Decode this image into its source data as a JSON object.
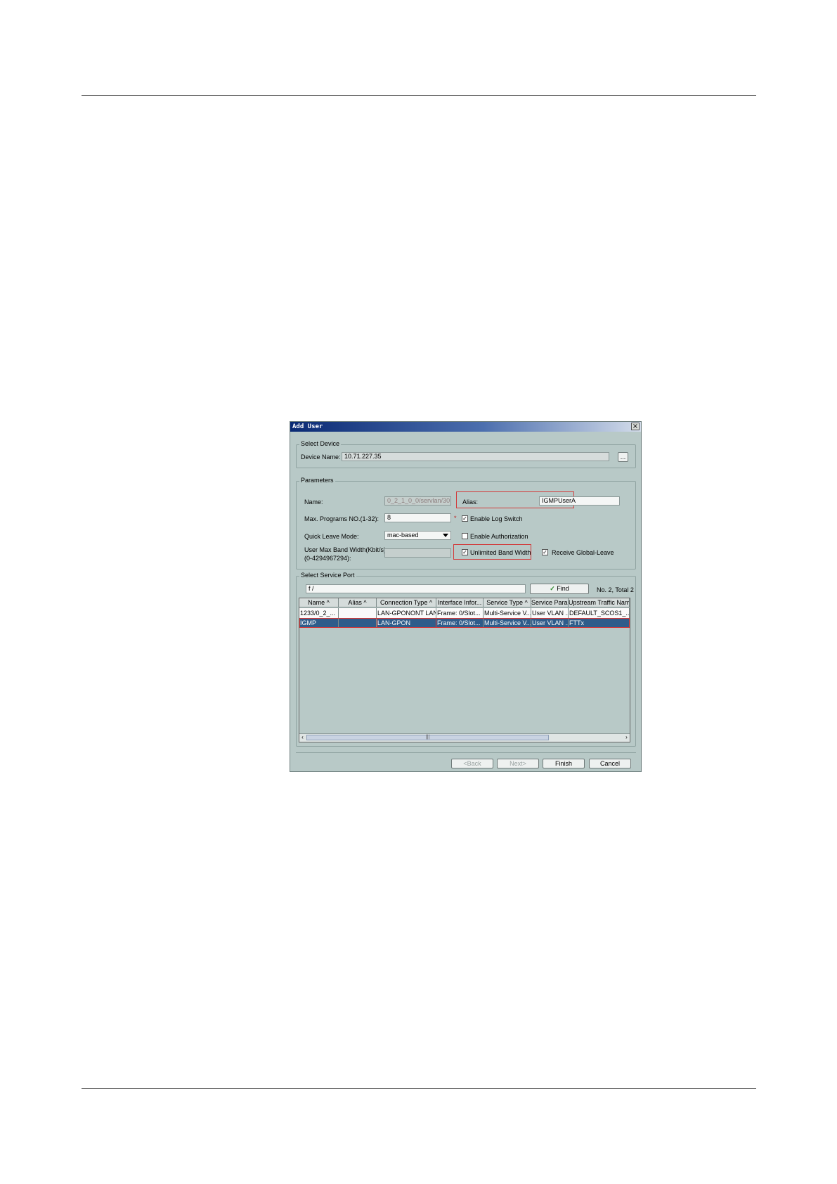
{
  "dialog": {
    "title": "Add User",
    "close_label": "×"
  },
  "select_device": {
    "legend": "Select Device",
    "device_name_label": "Device Name:",
    "device_name_value": "10.71.227.35",
    "browse_label": "..."
  },
  "parameters": {
    "legend": "Parameters",
    "name_label": "Name:",
    "name_value": "0_2_1_0_0/servlan/30",
    "alias_label": "Alias:",
    "alias_value": "IGMPUserA",
    "max_programs_label": "Max. Programs NO.(1-32):",
    "max_programs_value": "8",
    "required_mark": "*",
    "enable_log_switch_label": "Enable Log Switch",
    "enable_log_switch_checked": true,
    "quick_leave_label": "Quick Leave Mode:",
    "quick_leave_value": "mac-based",
    "enable_authorization_label": "Enable Authorization",
    "enable_authorization_checked": false,
    "band_width_label_line1": "User Max Band Width(Kbit/s)",
    "band_width_label_line2": "(0-4294967294):",
    "band_width_value": "",
    "unlimited_band_width_label": "Unlimited Band Width",
    "unlimited_band_width_checked": true,
    "receive_global_leave_label": "Receive Global-Leave",
    "receive_global_leave_checked": true
  },
  "service_port": {
    "legend": "Select Service Port",
    "filter_value": "f /",
    "find_label": "Find",
    "count_text": "No. 2, Total 2",
    "columns": [
      "Name ^",
      "Alias ^",
      "Connection Type ^",
      "Interface Infor...",
      "Service Type ^",
      "Service Para...",
      "Upstream Traffic Name"
    ],
    "rows": [
      [
        "1233/0_2_...",
        "",
        "LAN-GPONONT LAN",
        "Frame: 0/Slot...",
        "Multi-Service V...",
        "User VLAN ...",
        "DEFAULT_SCOS1_..."
      ],
      [
        "IGMP",
        "",
        "LAN-GPON",
        "Frame: 0/Slot...",
        "Multi-Service V...",
        "User VLAN ...",
        "FTTx"
      ]
    ],
    "selected_row": 1,
    "scroll_grip": "|||"
  },
  "buttons": {
    "back": "<Back",
    "next": "Next>",
    "finish": "Finish",
    "cancel": "Cancel"
  }
}
